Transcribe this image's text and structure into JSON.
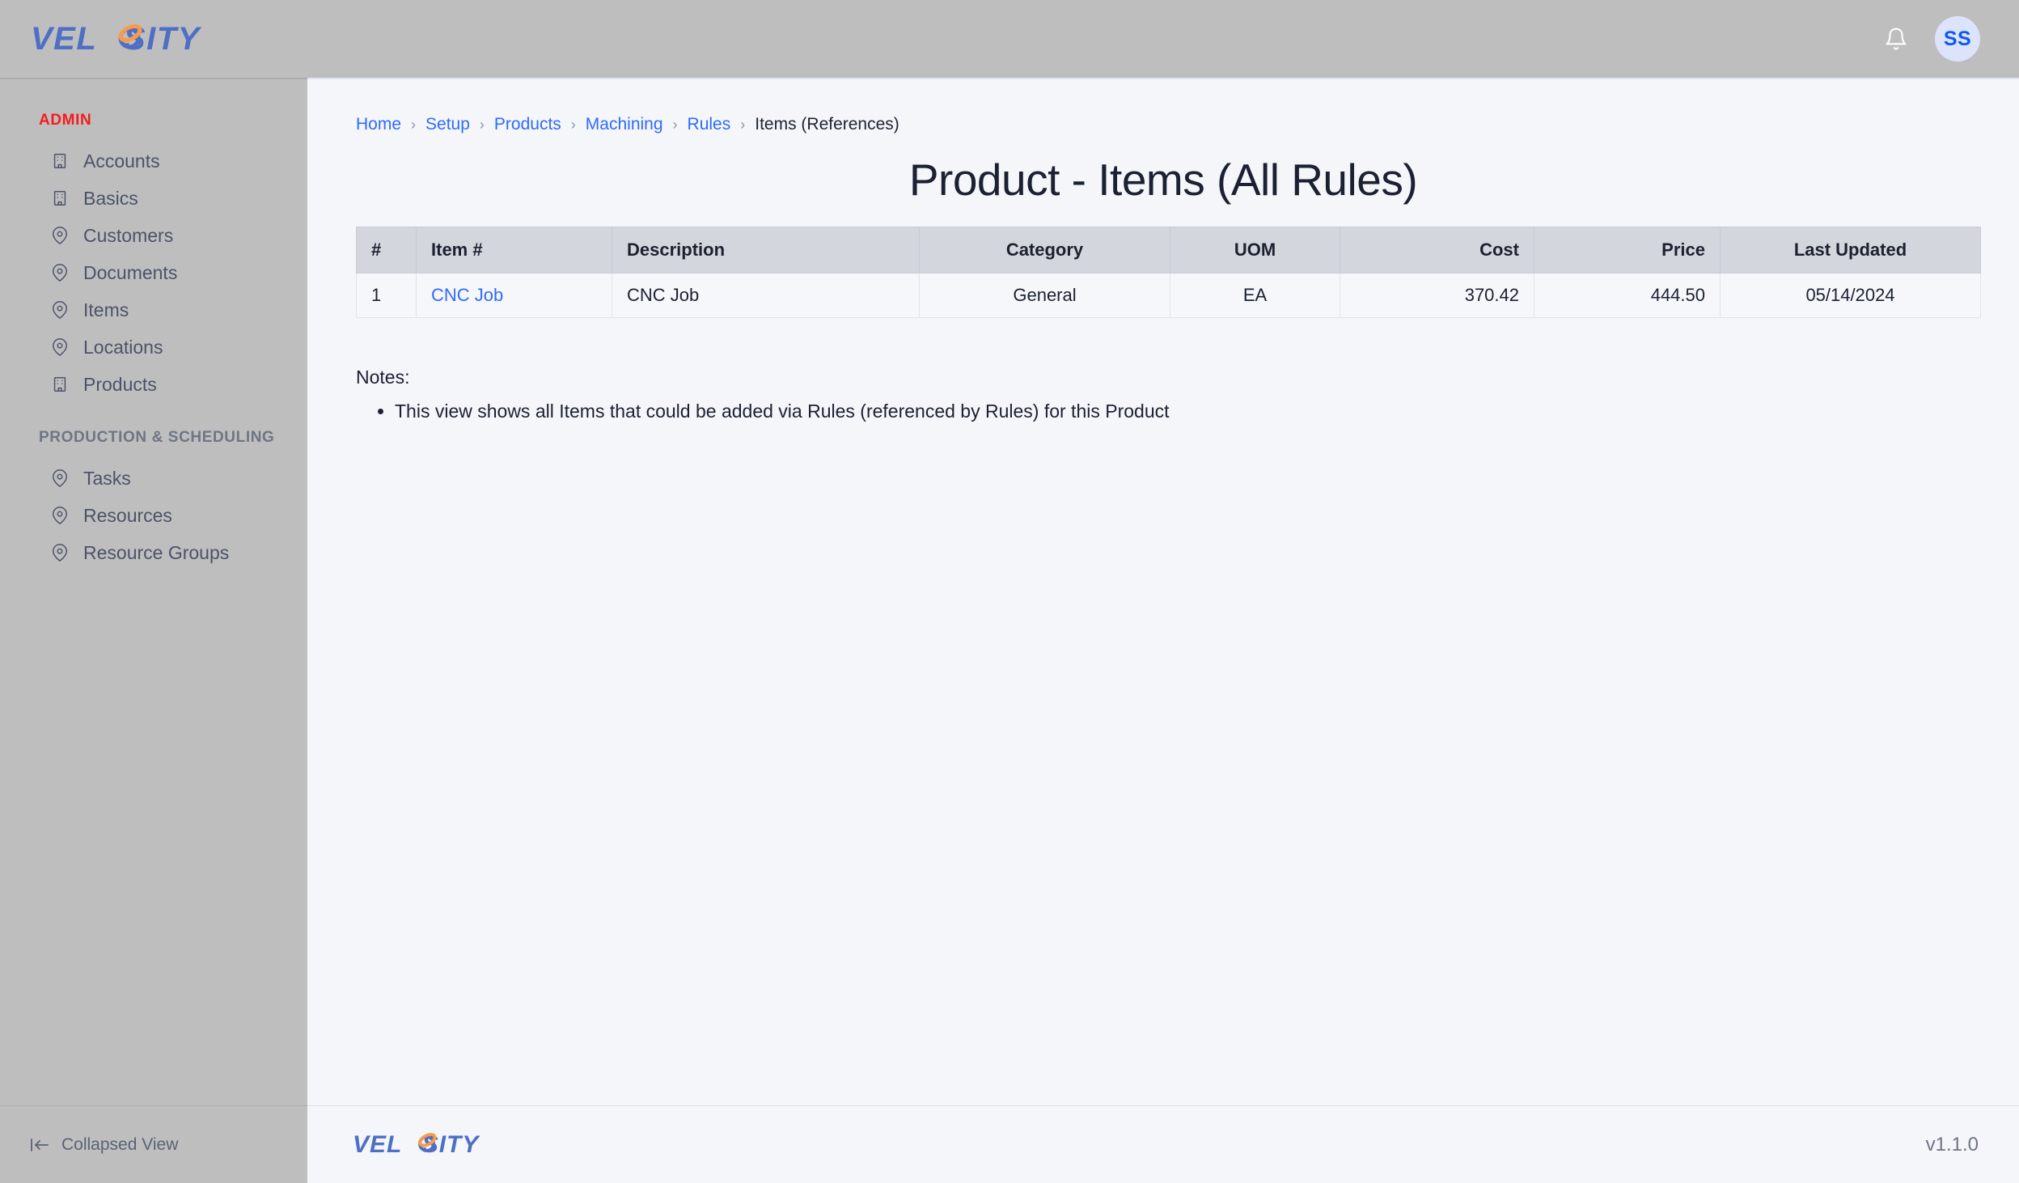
{
  "brand": {
    "name_part1": "VEL",
    "name_part2": "SITY",
    "full_name": "VELOSITY",
    "logo_blue": "#4f6fc4",
    "logo_orange": "#f79a4b"
  },
  "topbar": {
    "notifications_icon": "bell-icon",
    "avatar_initials": "SS"
  },
  "sidebar": {
    "sections": [
      {
        "title": "ADMIN",
        "title_color": "#f41c1c",
        "items": [
          {
            "label": "Accounts",
            "icon": "building-icon"
          },
          {
            "label": "Basics",
            "icon": "building-icon"
          },
          {
            "label": "Customers",
            "icon": "map-pin-icon"
          },
          {
            "label": "Documents",
            "icon": "map-pin-icon"
          },
          {
            "label": "Items",
            "icon": "map-pin-icon"
          },
          {
            "label": "Locations",
            "icon": "map-pin-icon"
          },
          {
            "label": "Products",
            "icon": "building-icon"
          }
        ]
      },
      {
        "title": "PRODUCTION & SCHEDULING",
        "title_color": "#6e7585",
        "items": [
          {
            "label": "Tasks",
            "icon": "map-pin-icon"
          },
          {
            "label": "Resources",
            "icon": "map-pin-icon"
          },
          {
            "label": "Resource Groups",
            "icon": "map-pin-icon"
          }
        ]
      }
    ],
    "collapse_label": "Collapsed View",
    "collapse_icon": "collapse-left-icon"
  },
  "breadcrumb": {
    "separator": "›",
    "links": [
      "Home",
      "Setup",
      "Products",
      "Machining",
      "Rules"
    ],
    "current": "Items (References)"
  },
  "main": {
    "page_title": "Product - Items (All Rules)",
    "table": {
      "headers": [
        "#",
        "Item #",
        "Description",
        "Category",
        "UOM",
        "Cost",
        "Price",
        "Last Updated"
      ],
      "rows": [
        {
          "index": "1",
          "item_number": "CNC Job",
          "description": "CNC Job",
          "category": "General",
          "uom": "EA",
          "cost": "370.42",
          "price": "444.50",
          "last_updated": "05/14/2024"
        }
      ]
    },
    "notes_label": "Notes:",
    "notes": [
      "This view shows all Items that could be added via Rules (referenced by Rules) for this Product"
    ]
  },
  "footer": {
    "version": "v1.1.0"
  }
}
